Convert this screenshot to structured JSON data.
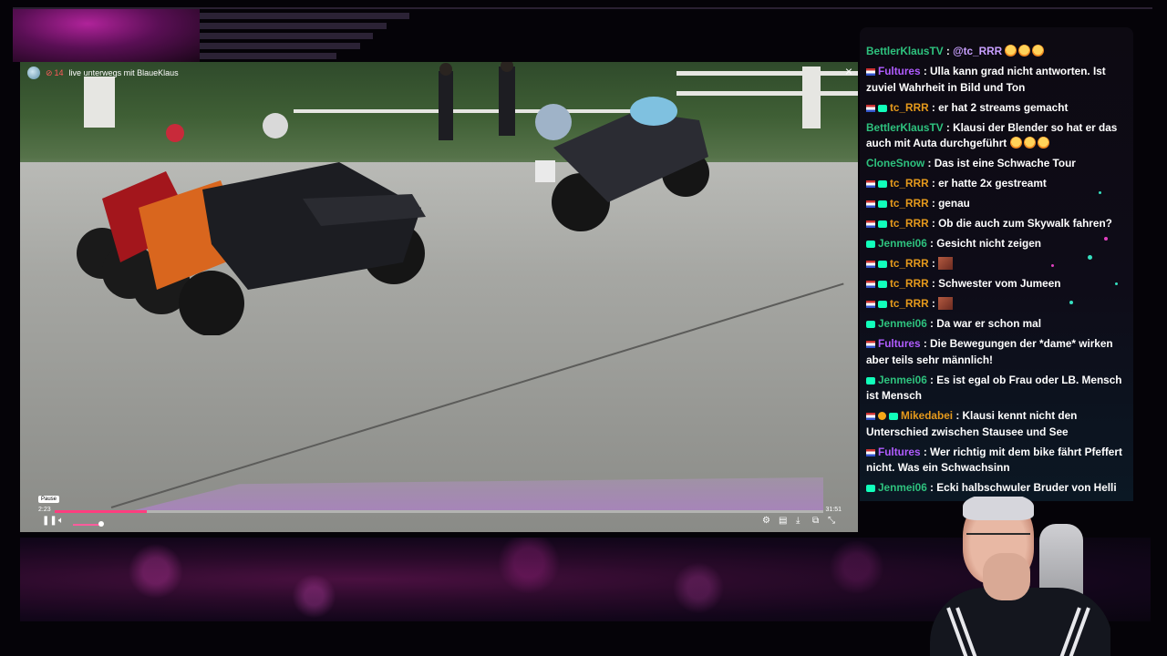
{
  "player": {
    "title": "live unterwegs mit BlaueKlaus",
    "viewer_count": "14",
    "close_icon": "×",
    "tooltip": "Pause",
    "current_time": "2:23",
    "total_time": "31:51",
    "progress_fraction": 0.12,
    "volume_fraction": 0.7
  },
  "chat": {
    "messages": [
      {
        "badges": [],
        "user": "BettlerKlausTV",
        "user_color": "#2ec27e",
        "text": "@tc_RRR",
        "text_color": "#c9a0ff",
        "emotes": 3
      },
      {
        "badges": [
          "flag"
        ],
        "user": "Fultures",
        "user_color": "#b05cff",
        "text": "Ulla kann grad nicht antworten. Ist zuviel Wahrheit in Bild und Ton"
      },
      {
        "badges": [
          "flag",
          "sub"
        ],
        "user": "tc_RRR",
        "user_color": "#e69a1c",
        "text": "er hat 2 streams gemacht"
      },
      {
        "badges": [],
        "user": "BettlerKlausTV",
        "user_color": "#2ec27e",
        "text": "Klausi der Blender so hat er das auch mit Auta durchgeführt",
        "emotes": 3
      },
      {
        "badges": [],
        "user": "CloneSnow",
        "user_color": "#2ec27e",
        "text": "Das ist eine Schwache Tour"
      },
      {
        "badges": [
          "flag",
          "sub"
        ],
        "user": "tc_RRR",
        "user_color": "#e69a1c",
        "text": "er hatte 2x gestreamt"
      },
      {
        "badges": [
          "flag",
          "sub"
        ],
        "user": "tc_RRR",
        "user_color": "#e69a1c",
        "text": "genau"
      },
      {
        "badges": [
          "flag",
          "sub"
        ],
        "user": "tc_RRR",
        "user_color": "#e69a1c",
        "text": "Ob die auch zum Skywalk fahren?"
      },
      {
        "badges": [
          "sub"
        ],
        "user": "Jenmei06",
        "user_color": "#2ec27e",
        "text": "Gesicht nicht zeigen"
      },
      {
        "badges": [
          "flag",
          "sub"
        ],
        "user": "tc_RRR",
        "user_color": "#e69a1c",
        "text": "",
        "image_emote": true
      },
      {
        "badges": [
          "flag",
          "sub"
        ],
        "user": "tc_RRR",
        "user_color": "#e69a1c",
        "text": "Schwester vom Jumeen"
      },
      {
        "badges": [
          "flag",
          "sub"
        ],
        "user": "tc_RRR",
        "user_color": "#e69a1c",
        "text": "",
        "image_emote": true
      },
      {
        "badges": [
          "sub"
        ],
        "user": "Jenmei06",
        "user_color": "#2ec27e",
        "text": "Da war er schon mal"
      },
      {
        "badges": [
          "flag"
        ],
        "user": "Fultures",
        "user_color": "#b05cff",
        "text": "Die Bewegungen der *dame* wirken aber teils sehr männlich!"
      },
      {
        "badges": [
          "sub"
        ],
        "user": "Jenmei06",
        "user_color": "#2ec27e",
        "text": "Es ist egal ob Frau oder LB. Mensch ist Mensch"
      },
      {
        "badges": [
          "flag",
          "mod",
          "sub"
        ],
        "user": "Mikedabei",
        "user_color": "#e69a1c",
        "text": "Klausi kennt nicht den Unterschied zwischen Stausee und See"
      },
      {
        "badges": [
          "flag"
        ],
        "user": "Fultures",
        "user_color": "#b05cff",
        "text": "Wer richtig mit dem bike fährt Pfeffert nicht. Was ein Schwachsinn"
      },
      {
        "badges": [
          "sub"
        ],
        "user": "Jenmei06",
        "user_color": "#2ec27e",
        "text": "Ecki halbschwuler Bruder von Helli"
      }
    ]
  },
  "icons": {
    "play_pause": "pause-icon",
    "volume": "volume-icon",
    "settings": "gear-icon",
    "theater": "theater-icon",
    "download": "download-icon",
    "pip": "pip-icon",
    "fullscreen": "fullscreen-icon"
  },
  "colors": {
    "progress": "#ff3e7f",
    "chat_bg": "#0d0a12"
  }
}
